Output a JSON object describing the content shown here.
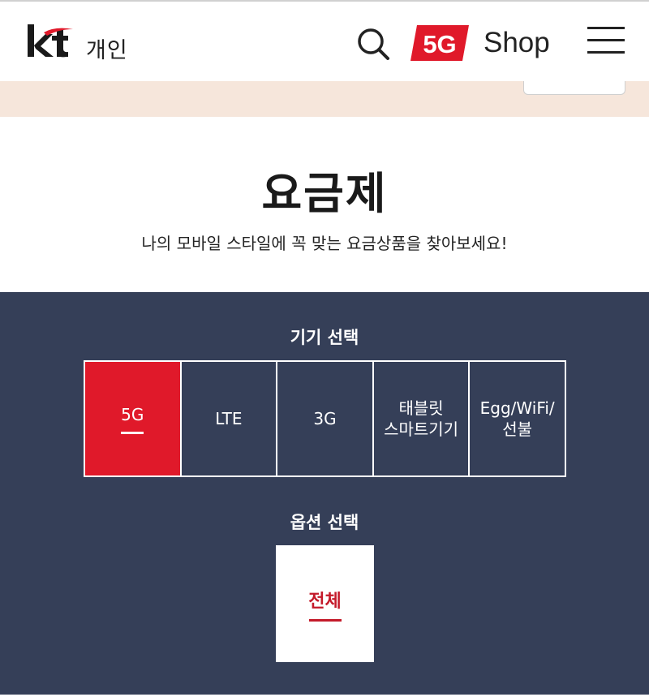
{
  "header": {
    "brand_label": "개인",
    "shop_badge": "5G",
    "shop_label": "Shop"
  },
  "title_section": {
    "title": "요금제",
    "subtitle": "나의 모바일 스타일에 꼭 맞는 요금상품을 찾아보세요!"
  },
  "device_select": {
    "label": "기기 선택",
    "tabs": [
      {
        "line1": "5G",
        "line2": "",
        "active": true
      },
      {
        "line1": "LTE",
        "line2": "",
        "active": false
      },
      {
        "line1": "3G",
        "line2": "",
        "active": false
      },
      {
        "line1": "태블릿",
        "line2": "스마트기기",
        "active": false
      },
      {
        "line1": "Egg/WiFi/",
        "line2": "선불",
        "active": false
      }
    ]
  },
  "option_select": {
    "label": "옵션 선택",
    "tabs": [
      {
        "label": "전체",
        "active": true
      }
    ]
  },
  "colors": {
    "accent_red": "#e0192a",
    "dark_navy": "#353f58",
    "beige": "#f6e6db"
  },
  "icons": {
    "logo": "kt-logo",
    "search": "search-icon",
    "menu": "hamburger-menu-icon"
  }
}
